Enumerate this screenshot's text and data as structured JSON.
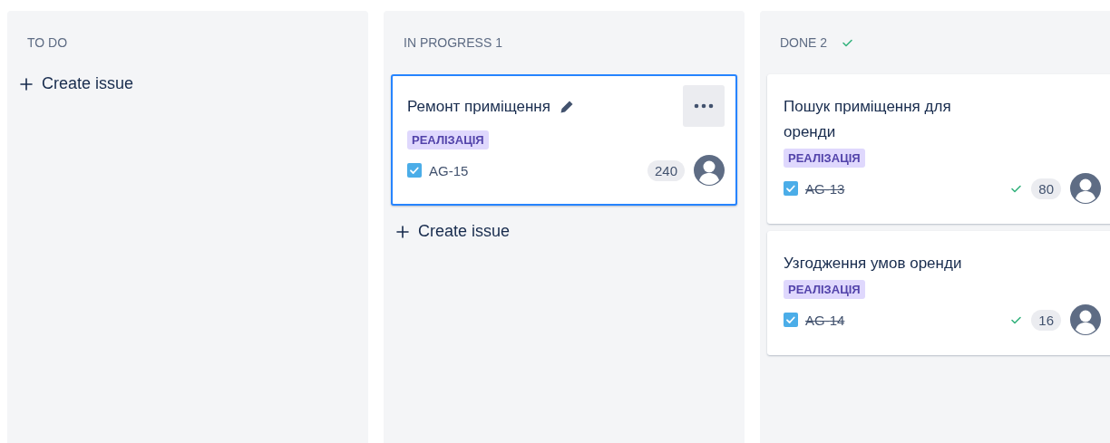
{
  "columns": [
    {
      "title": "TO DO",
      "done": false,
      "create_label": "Create issue"
    },
    {
      "title": "IN PROGRESS",
      "count": "1",
      "done": false,
      "create_label": "Create issue",
      "cards": [
        {
          "title": "Ремонт приміщення",
          "label": "РЕАЛІЗАЦІЯ",
          "key": "AG-15",
          "checked": true,
          "resolved": false,
          "estimate": "240",
          "selected": true,
          "hovered": true
        }
      ]
    },
    {
      "title": "DONE",
      "count": "2",
      "done": true,
      "cards": [
        {
          "title": "Пошук приміщення для оренди",
          "label": "РЕАЛІЗАЦІЯ",
          "key": "AG-13",
          "checked": true,
          "resolved": true,
          "estimate": "80",
          "selected": false,
          "hovered": false
        },
        {
          "title": "Узгодження умов оренди",
          "label": "РЕАЛІЗАЦІЯ",
          "key": "AG-14",
          "checked": true,
          "resolved": true,
          "estimate": "16",
          "selected": false,
          "hovered": false
        }
      ]
    }
  ]
}
